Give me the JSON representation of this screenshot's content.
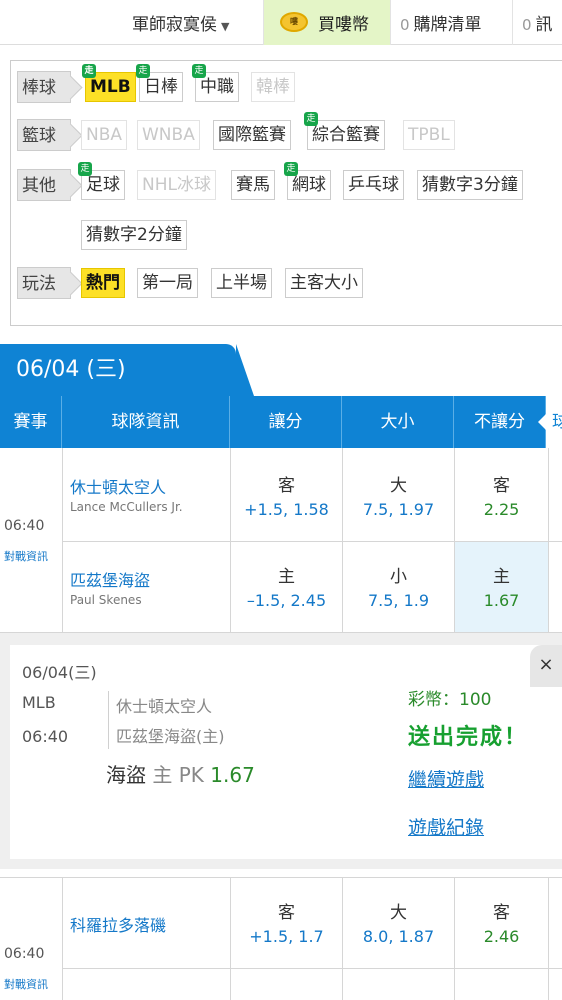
{
  "topbar": {
    "user": "軍師寂寞侯",
    "buy_coins_label": "買嘍幣",
    "coin_icon_text": "嘍",
    "cart_count": "0",
    "cart_label": "購牌清單",
    "msg_count": "0",
    "msg_label": "訊"
  },
  "filters": {
    "baseball": {
      "head": "棒球",
      "items": [
        "MLB",
        "日棒",
        "中職",
        "韓棒"
      ]
    },
    "basketball": {
      "head": "籃球",
      "items": [
        "NBA",
        "WNBA",
        "國際籃賽",
        "綜合籃賽",
        "TPBL"
      ]
    },
    "other": {
      "head": "其他",
      "items": [
        "足球",
        "NHL冰球",
        "賽馬",
        "網球",
        "乒乓球",
        "猜數字3分鐘",
        "猜數字2分鐘"
      ]
    },
    "play": {
      "head": "玩法",
      "items": [
        "熱門",
        "第一局",
        "上半場",
        "主客大小"
      ]
    },
    "badge": "走"
  },
  "date_tab": "06/04 (三)",
  "table_header": {
    "event": "賽事",
    "team_info": "球隊資訊",
    "spread": "讓分",
    "total": "大小",
    "moneyline": "不讓分",
    "next_tab": "球"
  },
  "matches": [
    {
      "time": "06:40",
      "vs_link": "對戰資訊",
      "away_team": "休士頓太空人",
      "away_pitcher": "Lance McCullers Jr.",
      "home_team": "匹茲堡海盜",
      "home_pitcher": "Paul Skenes",
      "spread_away_side": "客",
      "spread_away": "+1.5, 1.58",
      "spread_home_side": "主",
      "spread_home": "–1.5, 2.45",
      "total_over_side": "大",
      "total_over": "7.5, 1.97",
      "total_under_side": "小",
      "total_under": "7.5, 1.9",
      "ml_away_side": "客",
      "ml_away": "2.25",
      "ml_home_side": "主",
      "ml_home": "1.67"
    },
    {
      "time": "06:40",
      "vs_link": "對戰資訊",
      "away_team": "科羅拉多落磯",
      "spread_away_side": "客",
      "spread_away": "+1.5, 1.7",
      "total_over_side": "大",
      "total_over": "8.0, 1.87",
      "ml_away_side": "客",
      "ml_away": "2.46"
    }
  ],
  "bet_confirm": {
    "date": "06/04(三)",
    "league": "MLB",
    "time": "06:40",
    "away_team": "休士頓太空人",
    "home_team": "匹茲堡海盜(主)",
    "pick_team": "海盜",
    "pick_side": "主",
    "pick_type": "PK",
    "pick_odds": "1.67",
    "coins": "彩幣：100",
    "done": "送出完成！",
    "continue_link": "繼續遊戲",
    "history_link": "遊戲紀錄",
    "close": "×"
  }
}
